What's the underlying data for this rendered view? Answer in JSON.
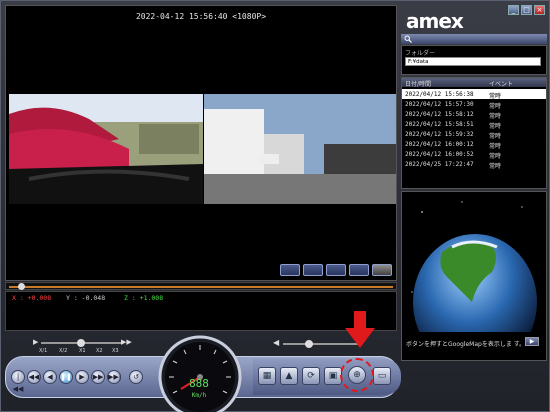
{
  "app": {
    "logo": "amex",
    "window_buttons": [
      "minimize",
      "maximize",
      "close"
    ]
  },
  "video": {
    "header": "2022-04-12 15:56:40 <1080P>",
    "view_modes": [
      "single-view",
      "dual-view",
      "pip-view",
      "wide-view",
      "fullscreen"
    ]
  },
  "graph": {
    "x": "X : +0.008",
    "y": "Y : -0.048",
    "z": "Z : +1.008"
  },
  "folder": {
    "label": "フォルダー",
    "value": "F:¥data"
  },
  "list": {
    "col_date": "日付/時間",
    "col_event": "イベント",
    "rows": [
      {
        "date": "2022/04/12 15:56:38",
        "event": "常時",
        "selected": true
      },
      {
        "date": "2022/04/12 15:57:30",
        "event": "常時",
        "selected": false
      },
      {
        "date": "2022/04/12 15:58:12",
        "event": "常時",
        "selected": false
      },
      {
        "date": "2022/04/12 15:58:51",
        "event": "常時",
        "selected": false
      },
      {
        "date": "2022/04/12 15:59:32",
        "event": "常時",
        "selected": false
      },
      {
        "date": "2022/04/12 16:00:12",
        "event": "常時",
        "selected": false
      },
      {
        "date": "2022/04/12 16:00:52",
        "event": "常時",
        "selected": false
      },
      {
        "date": "2022/04/25 17:22:47",
        "event": "常時",
        "selected": false
      }
    ]
  },
  "map": {
    "hint": "ボタンを押すとGoogleMapを表示しま す。",
    "button": "▶"
  },
  "speed": {
    "labels": [
      "X/1",
      "X/2",
      "X1",
      "X2",
      "X3"
    ],
    "readout": "888",
    "unit": "Km/h"
  },
  "controls": {
    "left": [
      "|◀◀",
      "◀◀",
      "◀",
      "❚❚",
      "▶",
      "▶▶",
      "▶▶|",
      "↺"
    ],
    "right_icons": [
      "film-icon",
      "mountain-icon",
      "rotate-icon",
      "save-icon",
      "gps-icon",
      "folder-icon"
    ]
  },
  "colors": {
    "accent_red": "#e01a1a",
    "gauge_green": "#5fe05f"
  }
}
